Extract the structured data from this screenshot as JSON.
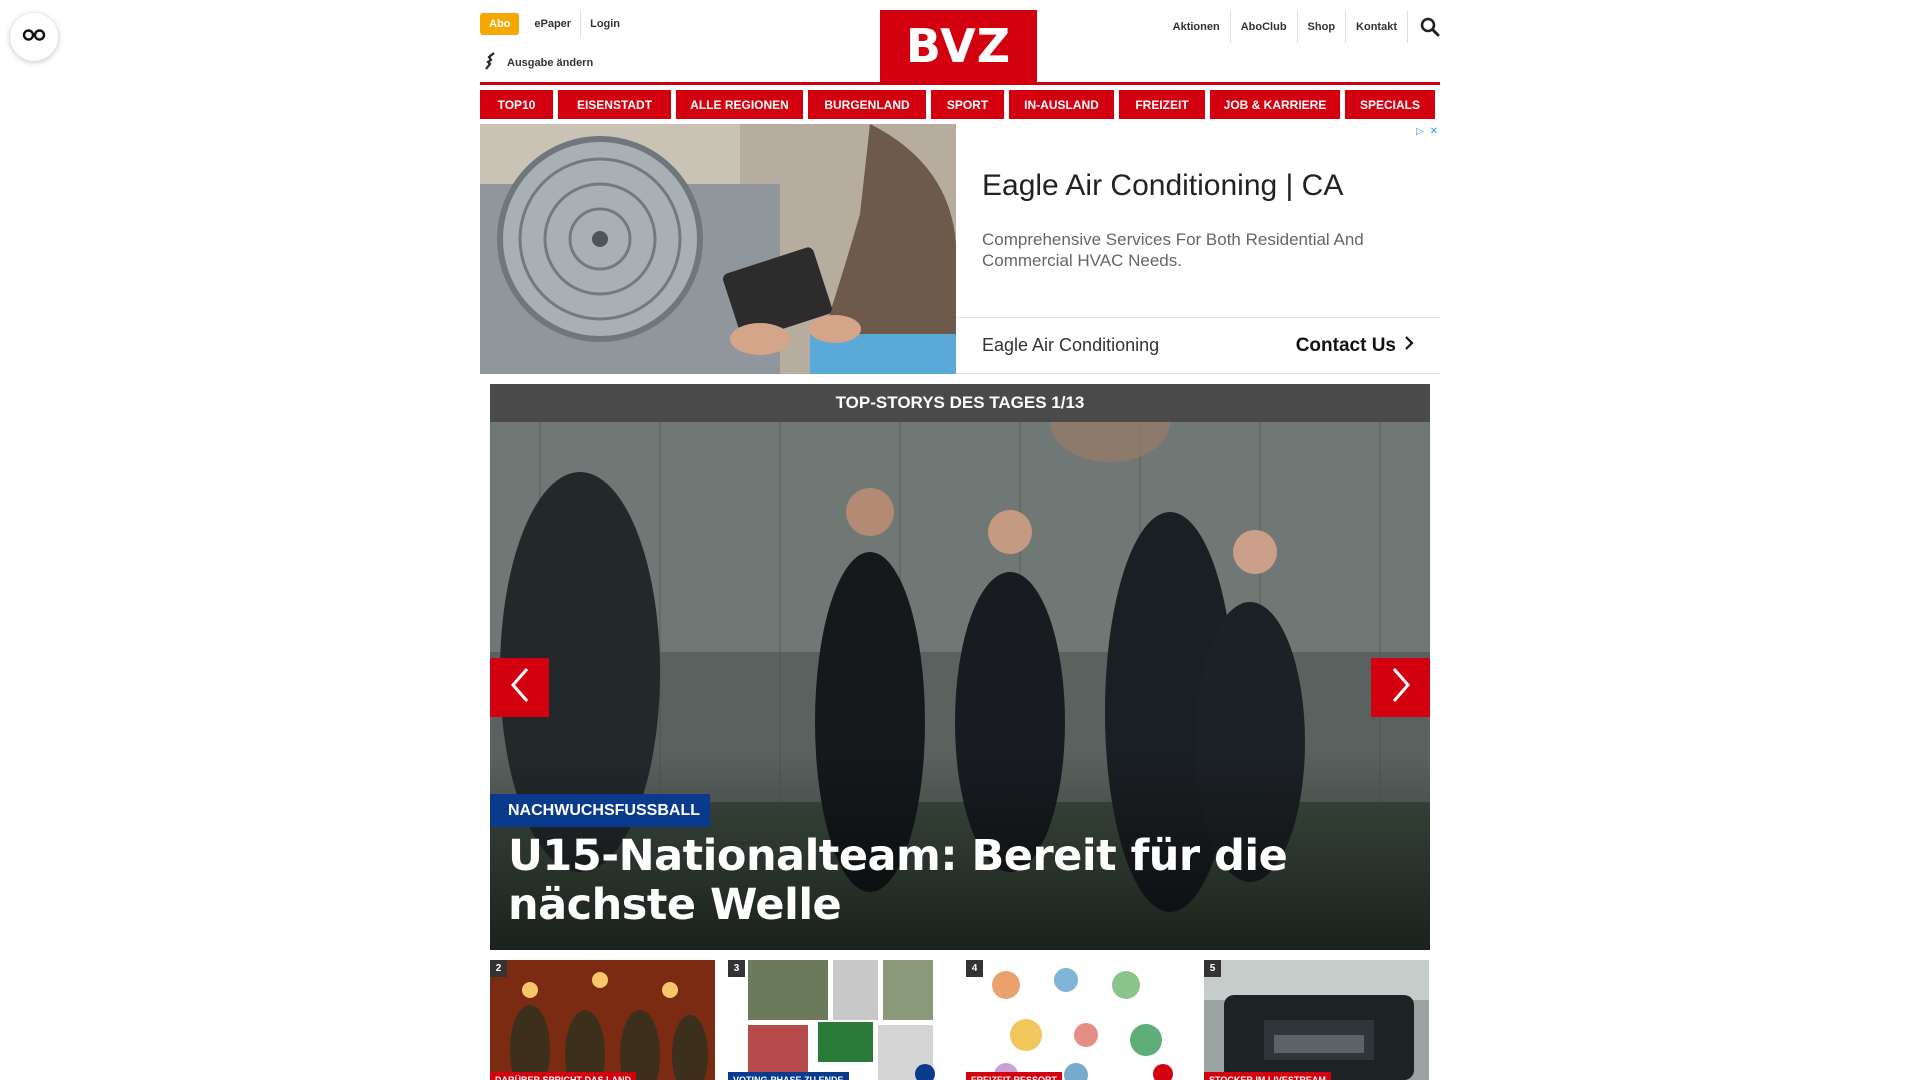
{
  "header": {
    "abo": "Abo",
    "epaper": "ePaper",
    "login": "Login",
    "edition": "Ausgabe ändern",
    "logo": "BVZ",
    "right_links": [
      "Aktionen",
      "AboClub",
      "Shop",
      "Kontakt"
    ]
  },
  "nav": [
    {
      "label": "TOP10"
    },
    {
      "label": "EISENSTADT"
    },
    {
      "label": "ALLE REGIONEN"
    },
    {
      "label": "BURGENLAND"
    },
    {
      "label": "SPORT"
    },
    {
      "label": "IN-AUSLAND"
    },
    {
      "label": "FREIZEIT"
    },
    {
      "label": "JOB & KARRIERE"
    },
    {
      "label": "SPECIALS"
    }
  ],
  "ad": {
    "title": "Eagle Air Conditioning | CA",
    "description": "Comprehensive Services For Both Residential And Commercial HVAC Needs.",
    "advertiser": "Eagle Air Conditioning",
    "cta": "Contact Us"
  },
  "stories": {
    "heading": "TOP-STORYS DES TAGES 1/13",
    "hero": {
      "category": "NACHWUCHSFUSSBALL",
      "title": "U15-Nationalteam: Bereit für die nächste Welle"
    },
    "thumbs": [
      {
        "num": "2",
        "label": "DARÜBER SPRICHT DAS LAND"
      },
      {
        "num": "3",
        "label": "VOTING-PHASE ZU ENDE"
      },
      {
        "num": "4",
        "label": "FREIZEIT-RESSORT"
      },
      {
        "num": "5",
        "label": "STOCKER IM LIVESTREAM"
      }
    ]
  },
  "colors": {
    "brand_red": "#d3000f",
    "abo_orange": "#f5a800",
    "category_blue": "#0a3a8c"
  }
}
